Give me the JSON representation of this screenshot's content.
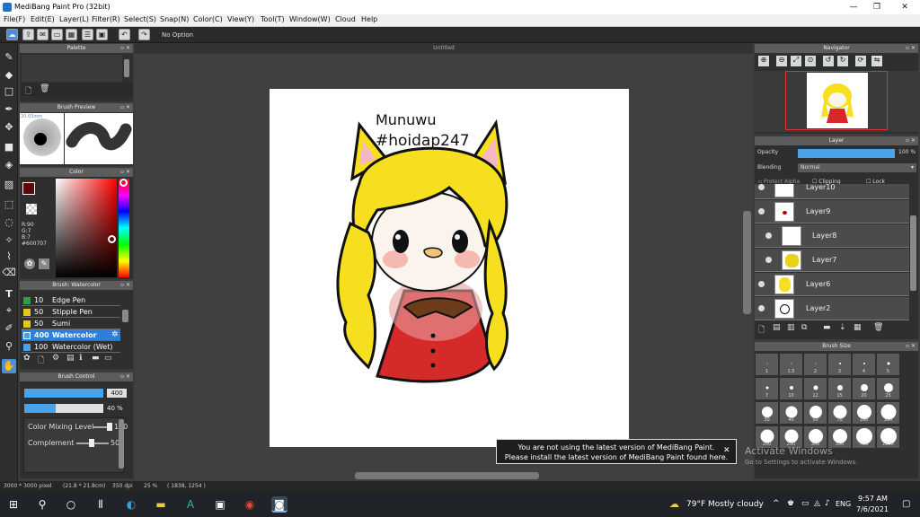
{
  "window": {
    "title": "MediBang Paint Pro (32bit)",
    "min": "—",
    "max": "❐",
    "close": "✕"
  },
  "menu": [
    "File(F)",
    "Edit(E)",
    "Layer(L)",
    "Filter(R)",
    "Select(S)",
    "Snap(N)",
    "Color(C)",
    "View(Y)",
    "Tool(T)",
    "Window(W)",
    "Cloud",
    "Help"
  ],
  "toolbar": {
    "option_label": "No Option"
  },
  "canvas": {
    "tab_title": "Untitled",
    "drawing_text_1": "Munuwu",
    "drawing_text_2": "#hoidap247"
  },
  "panels": {
    "palette": "Palette",
    "brush_preview": "Brush Preview",
    "brush_preview_size": "20.03mm",
    "color": "Color",
    "color_values": {
      "r": "R:90",
      "g": "G:7",
      "b": "B:7",
      "hex": "#600707"
    },
    "brush_list_title": "Brush: Watercolor",
    "brush_control": "Brush Control",
    "navigator": "Navigator",
    "layer": "Layer",
    "brush_size": "Brush Size"
  },
  "brushes": [
    {
      "size": "10",
      "name": "Edge Pen",
      "color": "#2ea043"
    },
    {
      "size": "50",
      "name": "Stipple Pen",
      "color": "#e6c619"
    },
    {
      "size": "50",
      "name": "Sumi",
      "color": "#e6c619"
    },
    {
      "size": "400",
      "name": "Watercolor",
      "color": "#4aa3e8"
    },
    {
      "size": "100",
      "name": "Watercolor (Wet)",
      "color": "#4aa3e8"
    }
  ],
  "brush_control": {
    "size_value": "400",
    "opacity_value": "40 %",
    "opacity_fraction": 0.4,
    "color_mixing_label": "Color Mixing Level",
    "color_mixing_value": "100",
    "complement_label": "Complement",
    "complement_value": "50"
  },
  "layer_panel": {
    "opacity_label": "Opacity",
    "opacity_value": "100 %",
    "blending_label": "Blending",
    "blending_value": "Normal",
    "protect_alpha": "Protect Alpha",
    "clipping": "Clipping",
    "lock": "Lock",
    "layers": [
      "Layer10",
      "Layer9",
      "Layer8",
      "Layer7",
      "Layer6",
      "Layer2"
    ]
  },
  "brush_sizes": [
    [
      "1",
      "1.5",
      "2",
      "3",
      "4",
      "5"
    ],
    [
      "7",
      "10",
      "12",
      "15",
      "20",
      "25"
    ],
    [
      "30",
      "40",
      "50",
      "70",
      "100",
      "150"
    ],
    [
      "200",
      "250",
      "300",
      "350",
      "700",
      "1000"
    ]
  ],
  "status": {
    "size": "3000 * 3000 pixel",
    "cm": "(21.8 * 21.8cm)",
    "dpi": "350 dpi",
    "zoom": "25 %",
    "coords": "( 1838, 1254 )"
  },
  "notice": {
    "line1": "You are not using the latest version of MediBang Paint.",
    "line2": "Please install the latest version of MediBang Paint found here.",
    "close": "✕"
  },
  "watermark": {
    "line1": "Activate Windows",
    "line2": "Go to Settings to activate Windows."
  },
  "taskbar": {
    "weather": "79°F  Mostly cloudy",
    "lang": "ENG",
    "time": "9:57 AM",
    "date": "7/6/2021"
  },
  "colors": {
    "accent": "#4a90d9",
    "fg_color": "#600707",
    "hair": "#f5df1f",
    "dress": "#d62a2a"
  }
}
